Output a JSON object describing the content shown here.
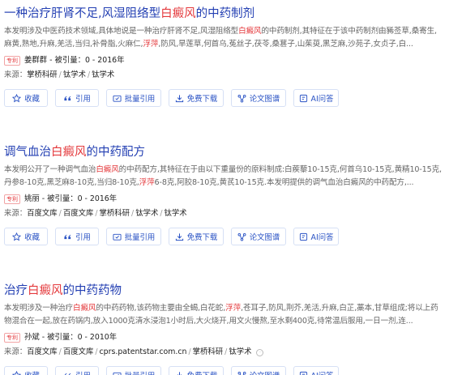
{
  "buttons": {
    "favorite": "收藏",
    "cite": "引用",
    "batch_cite": "批量引用",
    "download": "免费下载",
    "graph": "论文图谱",
    "ai_qa": "AI问答"
  },
  "results": [
    {
      "title_pre": "一种治疗肝肾不足,风湿阻络型",
      "title_hl": "白癜风",
      "title_post": "的中药制剂",
      "snippet_pre": "本发明涉及中医药技术领域,具体地说是一种治疗肝肾不足,风湿阻络型",
      "snippet_hl1": "白癜风",
      "snippet_mid": "的中药制剂,其特征在于该中药制剂由豨莶草,桑寄生,麻黄,熟地,升麻,羌活,当归,补骨脂,火麻仁,",
      "snippet_hl2": "浮萍",
      "snippet_post": ",防风,旱莲草,何首乌,菟丝子,茯苓,桑葚子,山茱萸,黑芝麻,沙苑子,女贞子,白...",
      "badge": "专利",
      "author_cite": "姜群群 - 被引量：0 - 2016年",
      "source_label": "来源：",
      "sources": [
        "掌桥科研",
        "钛学术",
        "钛学术"
      ]
    },
    {
      "title_pre": "调气血治",
      "title_hl": "白癜风",
      "title_post": "的中药配方",
      "snippet_pre": "本发明公开了一种调气血治",
      "snippet_hl1": "白癜风",
      "snippet_mid": "的中药配方,其特征在于由以下重量份的原料制成:白蒺藜10-15克,何首乌10-15克,黄精10-15克,丹参8-10克,黑芝麻8-10克,当归8-10克,",
      "snippet_hl2": "浮萍",
      "snippet_post": "6-8克,阿胶8-10克,黄芪10-15克.本发明提供的调气血治白癜风的中药配方,...",
      "badge": "专利",
      "author_cite": "姚丽 - 被引量：0 - 2016年",
      "source_label": "来源：",
      "sources": [
        "百度文库",
        "百度文库",
        "掌桥科研",
        "钛学术",
        "钛学术"
      ]
    },
    {
      "title_pre": "治疗",
      "title_hl": "白癜风",
      "title_post": "的中药药物",
      "snippet_pre": "本发明涉及一种治疗",
      "snippet_hl1": "白癜风",
      "snippet_mid": "的中药药物,该药物主要由全蝎,白花蛇,",
      "snippet_hl2": "浮萍",
      "snippet_post": ",苍耳子,防风,荆芥,羌活,升麻,白芷,藁本,甘草组成;将以上药物混合在一起,放在药锅内,放入1000克清水浸泡1小时后,大火烧开,用文火慢熬,至水剩400克,待常温后服用,一日一剂,连...",
      "badge": "专利",
      "author_cite": "孙斌 - 被引量：0 - 2010年",
      "source_label": "来源：",
      "sources": [
        "百度文库",
        "百度文库",
        "cprs.patentstar.com.cn",
        "掌桥科研",
        "钛学术"
      ]
    }
  ]
}
